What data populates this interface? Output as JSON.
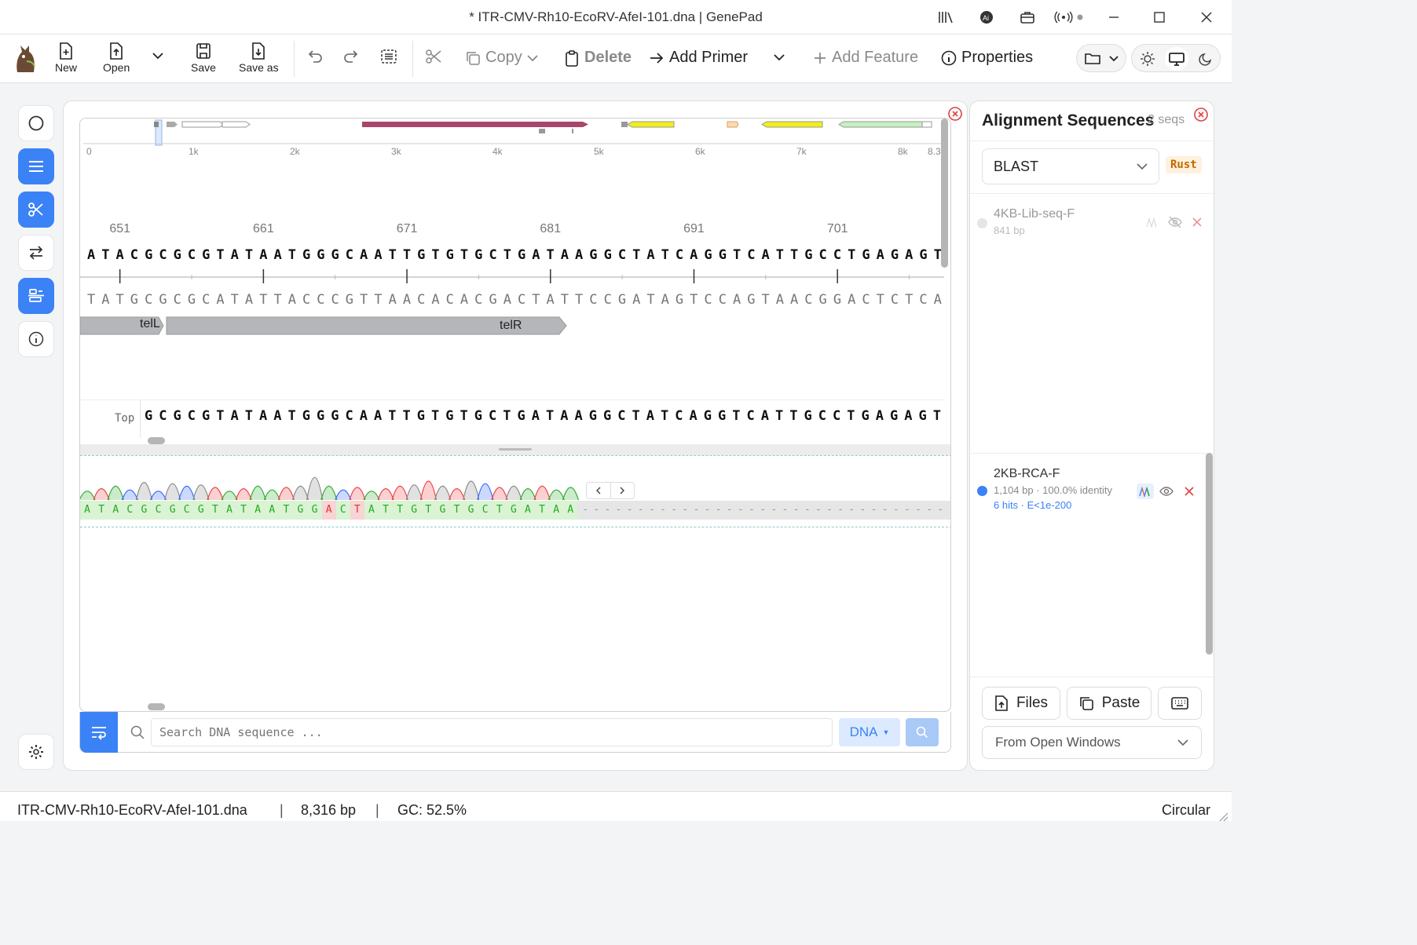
{
  "window": {
    "title": "* ITR-CMV-Rh10-EcoRV-AfeI-101.dna | GenePad"
  },
  "toolbar": {
    "new": "New",
    "open": "Open",
    "save": "Save",
    "save_as": "Save as",
    "copy": "Copy",
    "delete": "Delete",
    "add_primer": "Add Primer",
    "add_feature": "Add Feature",
    "properties": "Properties"
  },
  "map": {
    "ticks": [
      "0",
      "1k",
      "2k",
      "3k",
      "4k",
      "5k",
      "6k",
      "7k",
      "8k",
      "8.3k"
    ]
  },
  "seq": {
    "positions": [
      "651",
      "661",
      "671",
      "681",
      "691",
      "701"
    ],
    "top": "ATACGCGCGTATAATGGGCAATTGTGTGCTGATAAGGCTATCAGGTCATTGCCTGAGAGT",
    "bottom": "TATGCGCGCATATTACCCGTTAACACACGACTATTCCGATAGTCCAGTAACGGACTCTCA",
    "features": [
      {
        "label": "telL"
      },
      {
        "label": "telR"
      }
    ],
    "strand_label": "Top",
    "strand_seq": "GCGCGTATAATGGGCAATTGTGTGCTGATAAGGCTATCAGGTCATTGCCTGAGAGT"
  },
  "trace": {
    "seq": "ATACGCGCGTATAATGGACTATTGTGTGCTGATAA"
  },
  "search": {
    "placeholder": "Search DNA sequence ...",
    "mode": "DNA"
  },
  "panel": {
    "title": "Alignment Sequences",
    "count": "2 seqs",
    "engine": "BLAST",
    "engine_badge": "Rust",
    "items": [
      {
        "name": "4KB-Lib-seq-F",
        "meta": "841 bp",
        "hits": ""
      },
      {
        "name": "2KB-RCA-F",
        "meta": "1,104 bp · 100.0% identity",
        "hits": "6 hits · E<1e-200"
      }
    ],
    "files": "Files",
    "paste": "Paste",
    "source": "From Open Windows"
  },
  "status": {
    "file": "ITR-CMV-Rh10-EcoRV-AfeI-101.dna",
    "length": "8,316 bp",
    "gc": "GC: 52.5%",
    "topology": "Circular"
  },
  "colors": {
    "accent": "#3b82f6",
    "feature_maroon": "#a8466b",
    "feature_yellow": "#f2ee1a",
    "feature_green": "#c6f0c0",
    "feature_gray": "#b4b6ba"
  }
}
